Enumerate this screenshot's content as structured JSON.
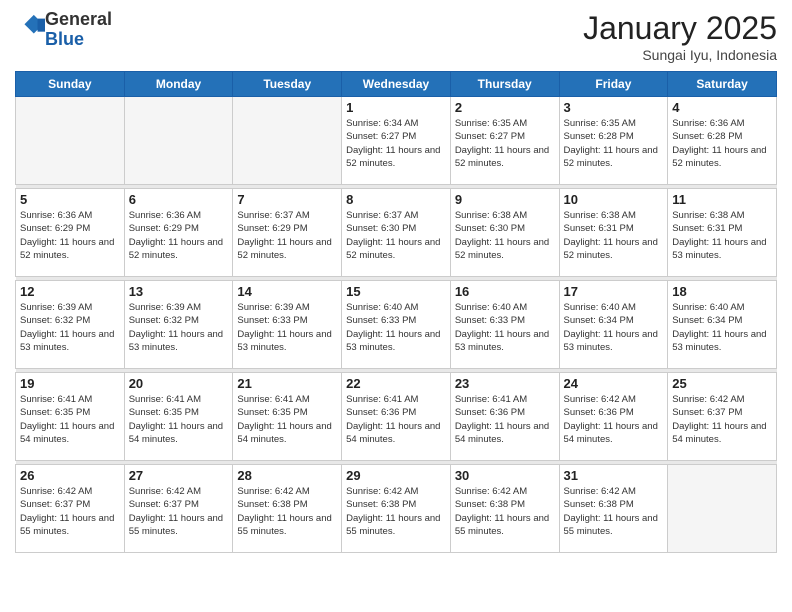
{
  "logo": {
    "general": "General",
    "blue": "Blue"
  },
  "header": {
    "month": "January 2025",
    "location": "Sungai Iyu, Indonesia"
  },
  "weekdays": [
    "Sunday",
    "Monday",
    "Tuesday",
    "Wednesday",
    "Thursday",
    "Friday",
    "Saturday"
  ],
  "weeks": [
    [
      {
        "day": "",
        "empty": true
      },
      {
        "day": "",
        "empty": true
      },
      {
        "day": "",
        "empty": true
      },
      {
        "day": "1",
        "sunrise": "Sunrise: 6:34 AM",
        "sunset": "Sunset: 6:27 PM",
        "daylight": "Daylight: 11 hours and 52 minutes."
      },
      {
        "day": "2",
        "sunrise": "Sunrise: 6:35 AM",
        "sunset": "Sunset: 6:27 PM",
        "daylight": "Daylight: 11 hours and 52 minutes."
      },
      {
        "day": "3",
        "sunrise": "Sunrise: 6:35 AM",
        "sunset": "Sunset: 6:28 PM",
        "daylight": "Daylight: 11 hours and 52 minutes."
      },
      {
        "day": "4",
        "sunrise": "Sunrise: 6:36 AM",
        "sunset": "Sunset: 6:28 PM",
        "daylight": "Daylight: 11 hours and 52 minutes."
      }
    ],
    [
      {
        "day": "5",
        "sunrise": "Sunrise: 6:36 AM",
        "sunset": "Sunset: 6:29 PM",
        "daylight": "Daylight: 11 hours and 52 minutes."
      },
      {
        "day": "6",
        "sunrise": "Sunrise: 6:36 AM",
        "sunset": "Sunset: 6:29 PM",
        "daylight": "Daylight: 11 hours and 52 minutes."
      },
      {
        "day": "7",
        "sunrise": "Sunrise: 6:37 AM",
        "sunset": "Sunset: 6:29 PM",
        "daylight": "Daylight: 11 hours and 52 minutes."
      },
      {
        "day": "8",
        "sunrise": "Sunrise: 6:37 AM",
        "sunset": "Sunset: 6:30 PM",
        "daylight": "Daylight: 11 hours and 52 minutes."
      },
      {
        "day": "9",
        "sunrise": "Sunrise: 6:38 AM",
        "sunset": "Sunset: 6:30 PM",
        "daylight": "Daylight: 11 hours and 52 minutes."
      },
      {
        "day": "10",
        "sunrise": "Sunrise: 6:38 AM",
        "sunset": "Sunset: 6:31 PM",
        "daylight": "Daylight: 11 hours and 52 minutes."
      },
      {
        "day": "11",
        "sunrise": "Sunrise: 6:38 AM",
        "sunset": "Sunset: 6:31 PM",
        "daylight": "Daylight: 11 hours and 53 minutes."
      }
    ],
    [
      {
        "day": "12",
        "sunrise": "Sunrise: 6:39 AM",
        "sunset": "Sunset: 6:32 PM",
        "daylight": "Daylight: 11 hours and 53 minutes."
      },
      {
        "day": "13",
        "sunrise": "Sunrise: 6:39 AM",
        "sunset": "Sunset: 6:32 PM",
        "daylight": "Daylight: 11 hours and 53 minutes."
      },
      {
        "day": "14",
        "sunrise": "Sunrise: 6:39 AM",
        "sunset": "Sunset: 6:33 PM",
        "daylight": "Daylight: 11 hours and 53 minutes."
      },
      {
        "day": "15",
        "sunrise": "Sunrise: 6:40 AM",
        "sunset": "Sunset: 6:33 PM",
        "daylight": "Daylight: 11 hours and 53 minutes."
      },
      {
        "day": "16",
        "sunrise": "Sunrise: 6:40 AM",
        "sunset": "Sunset: 6:33 PM",
        "daylight": "Daylight: 11 hours and 53 minutes."
      },
      {
        "day": "17",
        "sunrise": "Sunrise: 6:40 AM",
        "sunset": "Sunset: 6:34 PM",
        "daylight": "Daylight: 11 hours and 53 minutes."
      },
      {
        "day": "18",
        "sunrise": "Sunrise: 6:40 AM",
        "sunset": "Sunset: 6:34 PM",
        "daylight": "Daylight: 11 hours and 53 minutes."
      }
    ],
    [
      {
        "day": "19",
        "sunrise": "Sunrise: 6:41 AM",
        "sunset": "Sunset: 6:35 PM",
        "daylight": "Daylight: 11 hours and 54 minutes."
      },
      {
        "day": "20",
        "sunrise": "Sunrise: 6:41 AM",
        "sunset": "Sunset: 6:35 PM",
        "daylight": "Daylight: 11 hours and 54 minutes."
      },
      {
        "day": "21",
        "sunrise": "Sunrise: 6:41 AM",
        "sunset": "Sunset: 6:35 PM",
        "daylight": "Daylight: 11 hours and 54 minutes."
      },
      {
        "day": "22",
        "sunrise": "Sunrise: 6:41 AM",
        "sunset": "Sunset: 6:36 PM",
        "daylight": "Daylight: 11 hours and 54 minutes."
      },
      {
        "day": "23",
        "sunrise": "Sunrise: 6:41 AM",
        "sunset": "Sunset: 6:36 PM",
        "daylight": "Daylight: 11 hours and 54 minutes."
      },
      {
        "day": "24",
        "sunrise": "Sunrise: 6:42 AM",
        "sunset": "Sunset: 6:36 PM",
        "daylight": "Daylight: 11 hours and 54 minutes."
      },
      {
        "day": "25",
        "sunrise": "Sunrise: 6:42 AM",
        "sunset": "Sunset: 6:37 PM",
        "daylight": "Daylight: 11 hours and 54 minutes."
      }
    ],
    [
      {
        "day": "26",
        "sunrise": "Sunrise: 6:42 AM",
        "sunset": "Sunset: 6:37 PM",
        "daylight": "Daylight: 11 hours and 55 minutes."
      },
      {
        "day": "27",
        "sunrise": "Sunrise: 6:42 AM",
        "sunset": "Sunset: 6:37 PM",
        "daylight": "Daylight: 11 hours and 55 minutes."
      },
      {
        "day": "28",
        "sunrise": "Sunrise: 6:42 AM",
        "sunset": "Sunset: 6:38 PM",
        "daylight": "Daylight: 11 hours and 55 minutes."
      },
      {
        "day": "29",
        "sunrise": "Sunrise: 6:42 AM",
        "sunset": "Sunset: 6:38 PM",
        "daylight": "Daylight: 11 hours and 55 minutes."
      },
      {
        "day": "30",
        "sunrise": "Sunrise: 6:42 AM",
        "sunset": "Sunset: 6:38 PM",
        "daylight": "Daylight: 11 hours and 55 minutes."
      },
      {
        "day": "31",
        "sunrise": "Sunrise: 6:42 AM",
        "sunset": "Sunset: 6:38 PM",
        "daylight": "Daylight: 11 hours and 55 minutes."
      },
      {
        "day": "",
        "empty": true
      }
    ]
  ]
}
